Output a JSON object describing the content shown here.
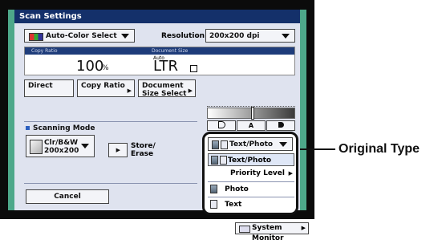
{
  "window": {
    "title": "Scan Settings"
  },
  "top_row": {
    "color_select_label": "Auto-Color Select",
    "resolution_label": "Resolution:",
    "resolution_value": "200x200 dpi"
  },
  "info": {
    "copy_ratio_caption": "Copy Ratio",
    "copy_ratio_value": "100",
    "copy_ratio_unit": "%",
    "doc_size_caption": "Document Size",
    "doc_size_auto": "Auto",
    "doc_size_value": "LTR"
  },
  "buttons": {
    "direct": "Direct",
    "copy_ratio": "Copy Ratio",
    "document_size_line1": "Document",
    "document_size_line2": "Size Select",
    "cancel": "Cancel",
    "store_erase_line1": "Store/",
    "store_erase_line2": "Erase"
  },
  "scanning_mode": {
    "label": "Scanning Mode",
    "value_line1": "Clr/B&W",
    "value_line2": "200x200"
  },
  "density": {
    "light_label": "",
    "auto_label": "A",
    "dark_label": ""
  },
  "original_type": {
    "selected": "Text/Photo",
    "options": [
      "Text/Photo",
      "Priority Level",
      "Photo",
      "Text"
    ]
  },
  "callout": {
    "label": "Original Type"
  },
  "status": {
    "system_monitor": "System Monitor"
  },
  "colors": {
    "title_bg": "#14306a",
    "panel_bg": "#dfe3ef",
    "frame_green": "#4da88a",
    "highlight": "#1e3c7a"
  }
}
